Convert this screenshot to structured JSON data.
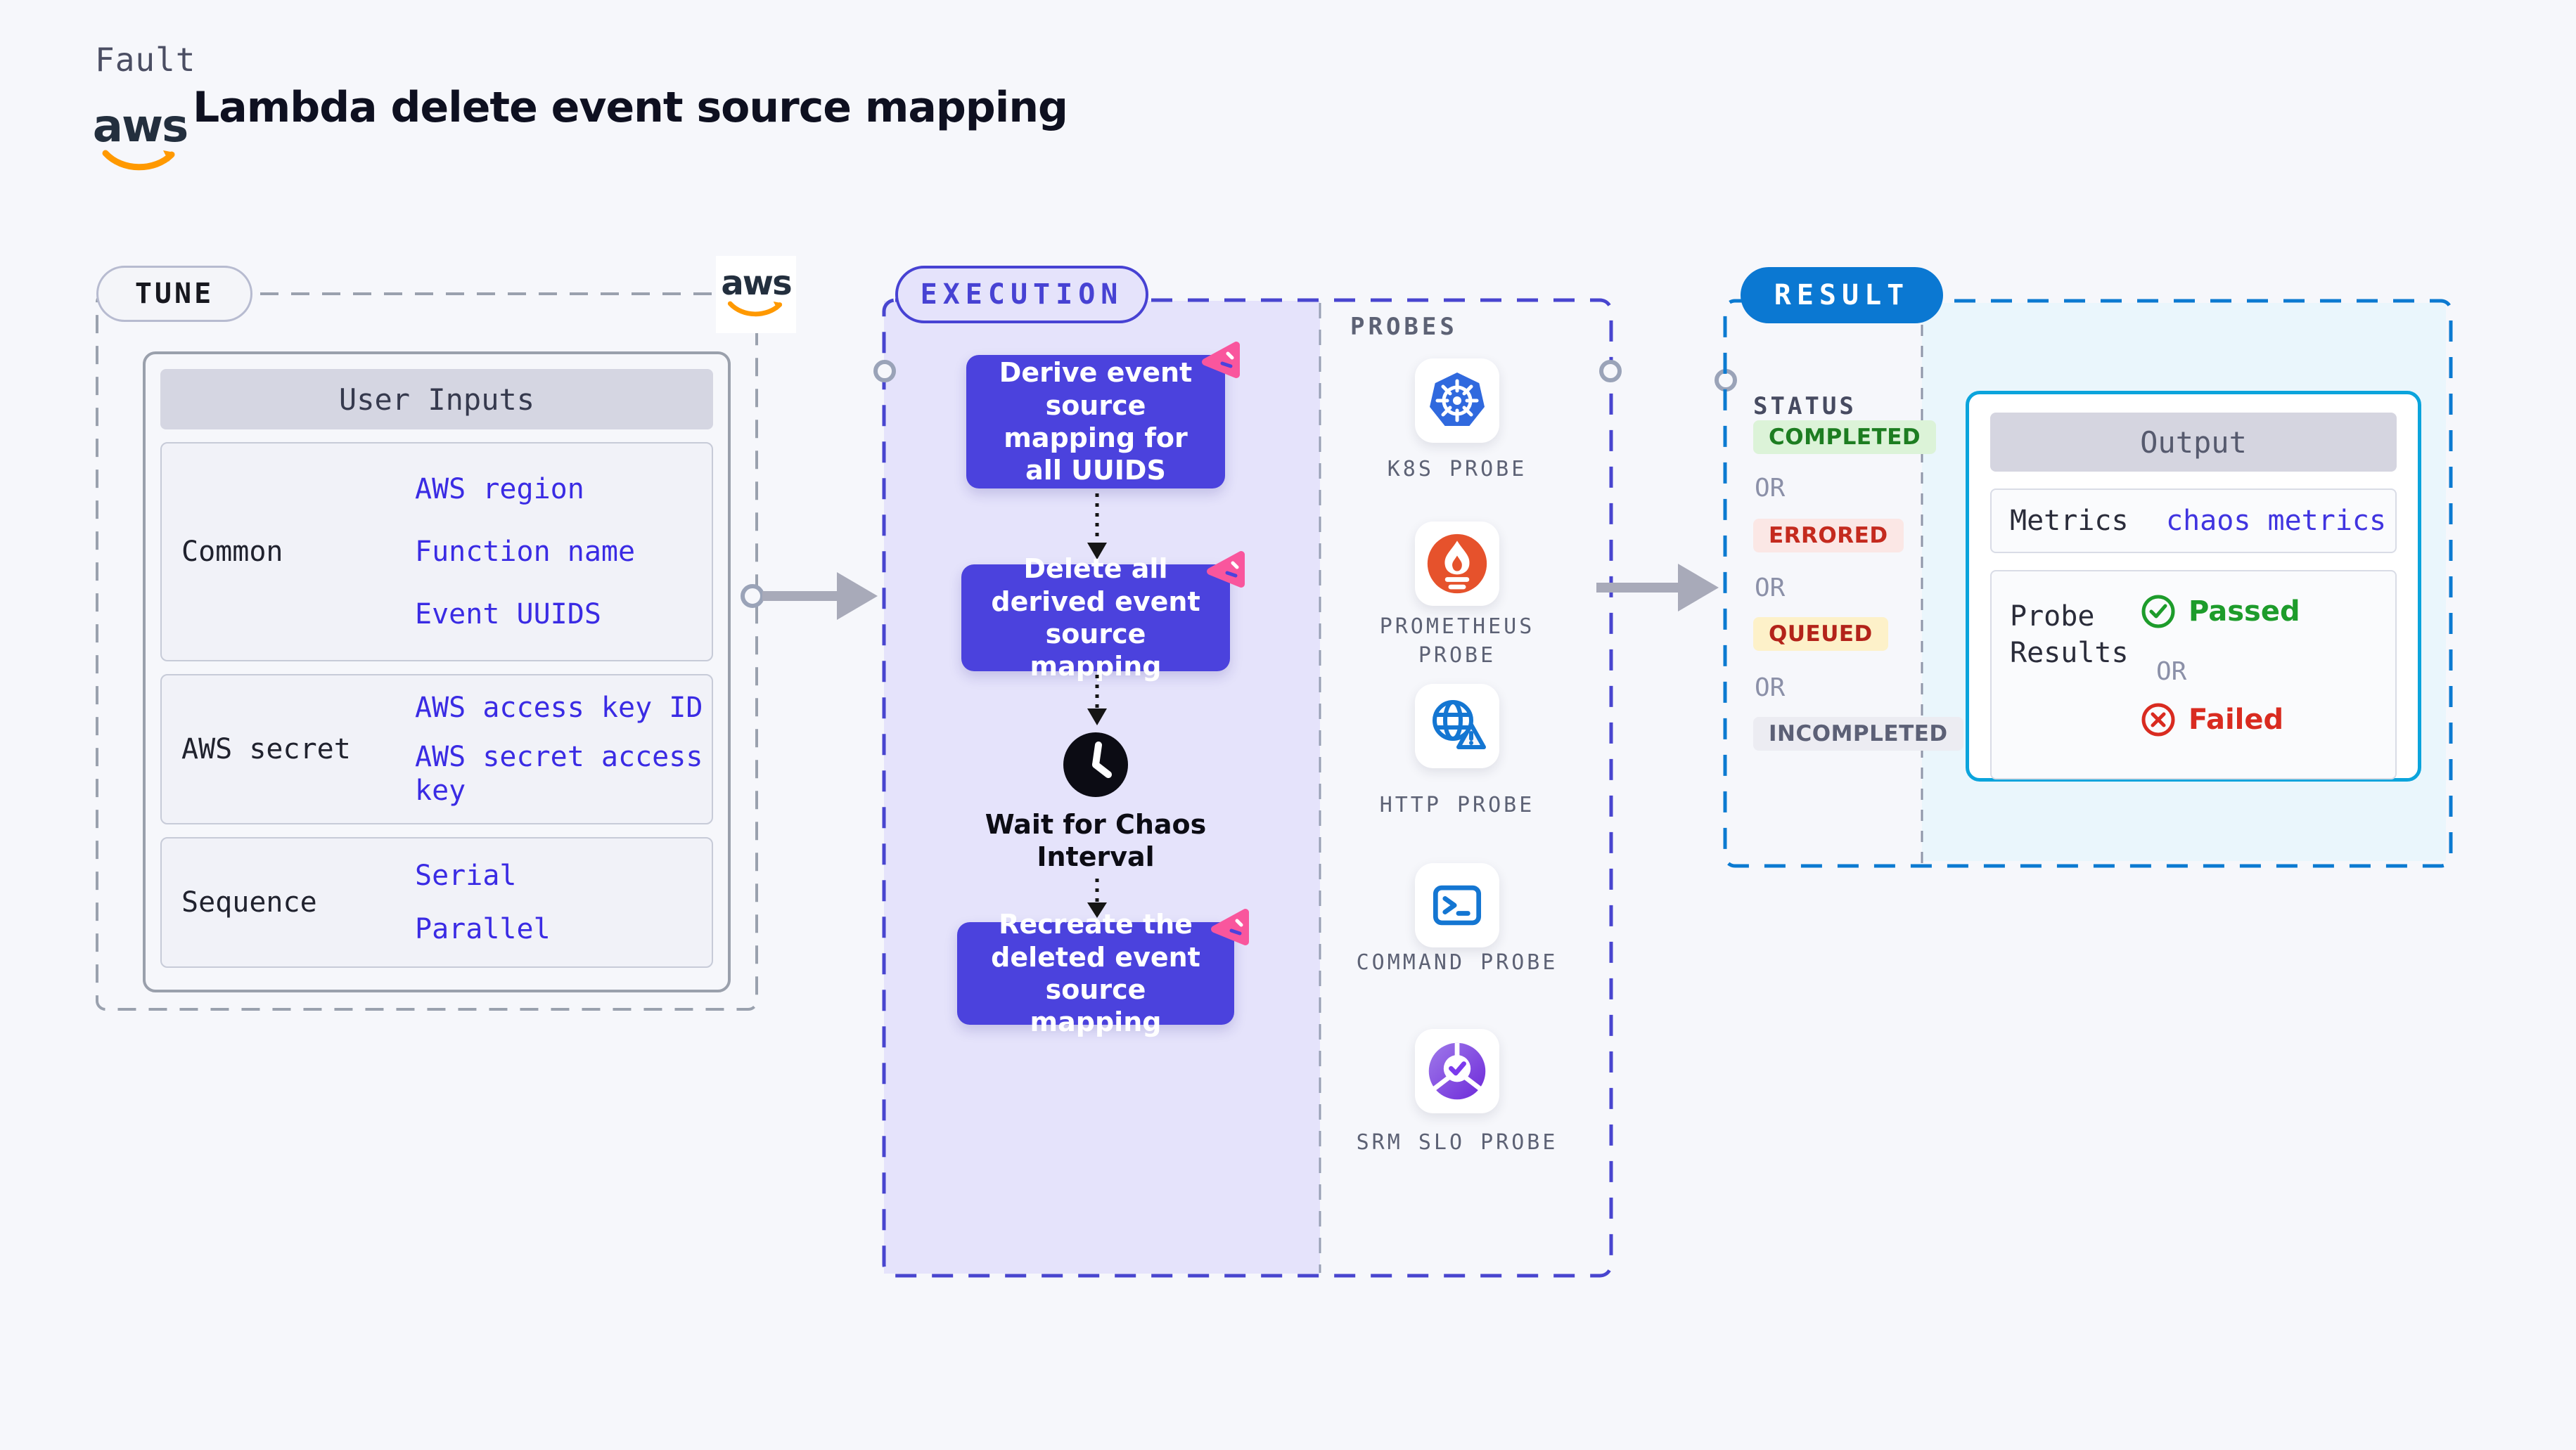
{
  "header": {
    "kind_label": "Fault",
    "title": "Lambda delete event source mapping",
    "aws_logo_text": "aws"
  },
  "tune": {
    "badge": "TUNE",
    "user_inputs": {
      "header": "User Inputs",
      "rows": [
        {
          "label": "Common",
          "links": [
            "AWS region",
            "Function name",
            "Event UUIDS"
          ]
        },
        {
          "label": "AWS secret",
          "links": [
            "AWS access key ID",
            "AWS secret access key"
          ]
        },
        {
          "label": "Sequence",
          "links": [
            "Serial",
            "Parallel"
          ]
        }
      ]
    }
  },
  "execution": {
    "badge": "EXECUTION",
    "steps": [
      "Derive event source mapping for all UUIDS",
      "Delete all derived event source mapping",
      "Wait for Chaos Interval",
      "Recreate the deleted event source mapping"
    ]
  },
  "probes": {
    "label": "PROBES",
    "items": [
      {
        "name": "K8S PROBE"
      },
      {
        "name": "PROMETHEUS PROBE"
      },
      {
        "name": "HTTP PROBE"
      },
      {
        "name": "COMMAND PROBE"
      },
      {
        "name": "SRM SLO PROBE"
      }
    ]
  },
  "result": {
    "badge": "RESULT",
    "status_label": "STATUS",
    "or_label": "OR",
    "statuses": [
      {
        "label": "COMPLETED",
        "tone": "green"
      },
      {
        "label": "ERRORED",
        "tone": "red"
      },
      {
        "label": "QUEUED",
        "tone": "yellow"
      },
      {
        "label": "INCOMPLETED",
        "tone": "muted"
      }
    ],
    "output": {
      "header": "Output",
      "metrics_label": "Metrics",
      "metrics_link": "chaos metrics",
      "probe_results_label": "Probe Results",
      "passed_label": "Passed",
      "failed_label": "Failed"
    }
  },
  "colors": {
    "page_bg": "#F6F7FB",
    "accent_indigo": "#4b42dd",
    "lavender_bg": "#E5E3FB",
    "chaos_pink": "#F9569D",
    "result_blue": "#0b78d2",
    "output_border": "#0ba4dc",
    "cyan_bg": "#EAF6FC",
    "link_blue": "#3a2be4",
    "completed_green": "#1d7d21",
    "errored_red": "#c42a1e",
    "queued_bg": "#fdf1c9",
    "incompleted_gray": "#5c6076",
    "passed_green": "#1d9c2b",
    "failed_red": "#d92b20",
    "aws_orange": "#FF9900",
    "k8s_blue": "#3069DE",
    "prometheus_orange": "#E6522C"
  }
}
